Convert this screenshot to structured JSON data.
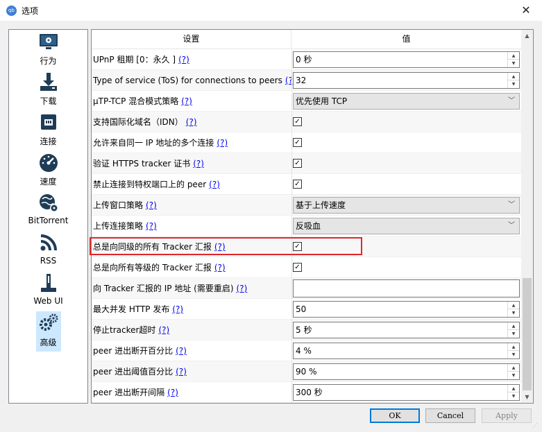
{
  "window": {
    "title": "选项",
    "app_icon": "qb",
    "close_glyph": "✕"
  },
  "sidebar": {
    "items": [
      {
        "label": "行为",
        "icon": "behavior-icon"
      },
      {
        "label": "下载",
        "icon": "download-icon"
      },
      {
        "label": "连接",
        "icon": "connection-icon"
      },
      {
        "label": "速度",
        "icon": "speed-icon"
      },
      {
        "label": "BitTorrent",
        "icon": "bittorrent-icon"
      },
      {
        "label": "RSS",
        "icon": "rss-icon"
      },
      {
        "label": "Web UI",
        "icon": "webui-icon"
      },
      {
        "label": "高级",
        "icon": "advanced-icon",
        "selected": true
      }
    ]
  },
  "table": {
    "headers": [
      "设置",
      "值"
    ],
    "help_text": "(?)",
    "rows": [
      {
        "label": "UPnP 租期 [0：永久 ]",
        "type": "spin",
        "value": "0 秒"
      },
      {
        "label": "Type of service (ToS) for connections to peers",
        "type": "spin",
        "value": "32"
      },
      {
        "label": "μTP-TCP 混合模式策略",
        "type": "combo",
        "value": "优先使用 TCP"
      },
      {
        "label": "支持国际化域名（IDN）",
        "type": "check",
        "value": "✓"
      },
      {
        "label": "允许来自同一 IP 地址的多个连接",
        "type": "check",
        "value": "✓"
      },
      {
        "label": "验证 HTTPS tracker 证书",
        "type": "check",
        "value": "✓"
      },
      {
        "label": "禁止连接到特权端口上的 peer",
        "type": "check",
        "value": "✓"
      },
      {
        "label": "上传窗口策略",
        "type": "combo",
        "value": "基于上传速度"
      },
      {
        "label": "上传连接策略",
        "type": "combo",
        "value": "反吸血"
      },
      {
        "label": "总是向同级的所有 Tracker 汇报",
        "type": "check",
        "value": "✓",
        "highlighted": true
      },
      {
        "label": "总是向所有等级的 Tracker 汇报",
        "type": "check",
        "value": "✓"
      },
      {
        "label": "向 Tracker 汇报的 IP 地址 (需要重启)",
        "type": "text",
        "value": ""
      },
      {
        "label": "最大并发 HTTP 发布",
        "type": "spin",
        "value": "50"
      },
      {
        "label": "停止tracker超时",
        "type": "spin",
        "value": "5 秒"
      },
      {
        "label": "peer 进出断开百分比",
        "type": "spin",
        "value": "4 %"
      },
      {
        "label": "peer 进出阈值百分比",
        "type": "spin",
        "value": "90 %"
      },
      {
        "label": "peer 进出断开间隔",
        "type": "spin",
        "value": "300 秒"
      }
    ]
  },
  "buttons": {
    "ok": "OK",
    "cancel": "Cancel",
    "apply": "Apply"
  },
  "colors": {
    "highlight_border": "#e0272b",
    "selected_nav": "#cce8ff",
    "link": "#0000ee",
    "default_button_border": "#0078d7"
  }
}
